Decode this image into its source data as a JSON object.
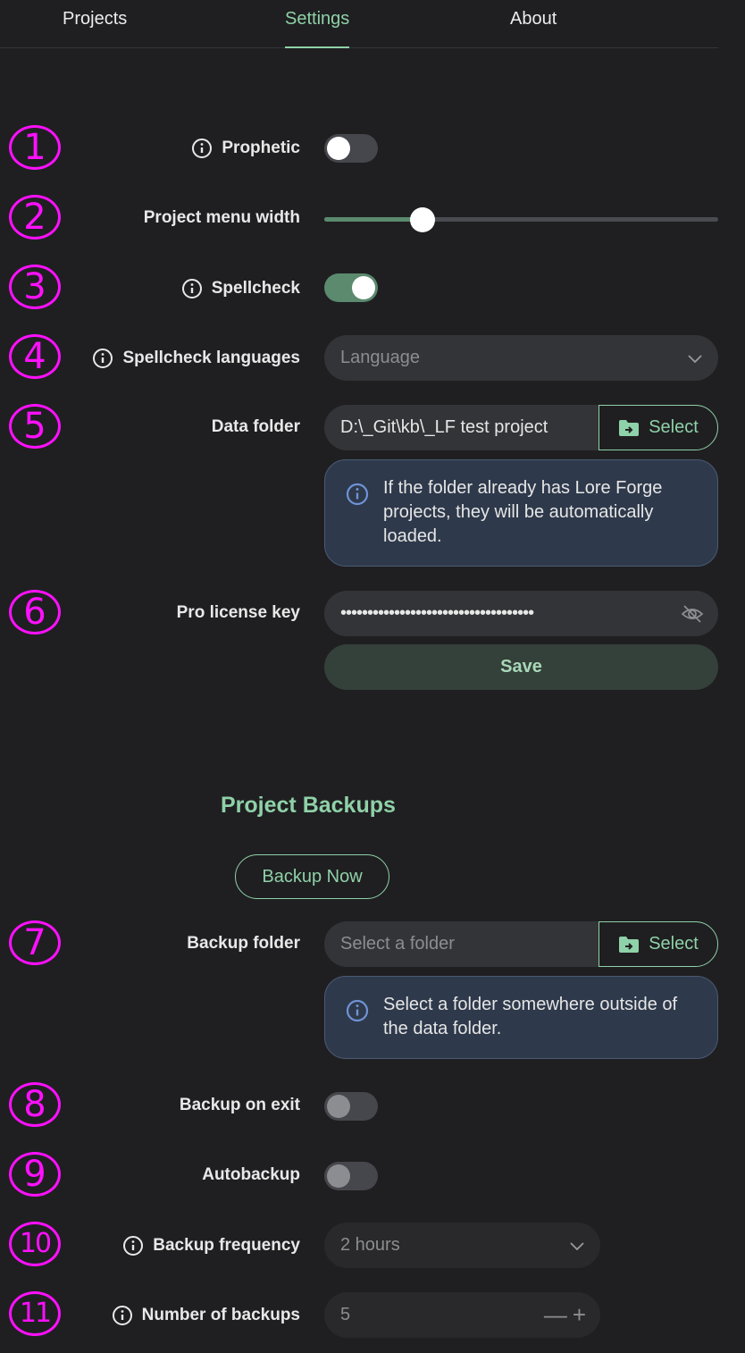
{
  "tabs": [
    {
      "label": "Projects"
    },
    {
      "label": "Settings"
    },
    {
      "label": "About"
    }
  ],
  "badges": [
    "1",
    "2",
    "3",
    "4",
    "5",
    "6",
    "7",
    "8",
    "9",
    "10",
    "11"
  ],
  "settings": {
    "prophetic": {
      "label": "Prophetic",
      "enabled": false
    },
    "menu_width": {
      "label": "Project menu width",
      "value_percent": 25
    },
    "spellcheck": {
      "label": "Spellcheck",
      "enabled": true
    },
    "spellcheck_languages": {
      "label": "Spellcheck languages",
      "placeholder": "Language"
    },
    "data_folder": {
      "label": "Data folder",
      "value": "D:\\_Git\\kb\\_LF test project",
      "select_label": "Select",
      "info": "If the folder already has Lore Forge projects, they will be automatically loaded."
    },
    "license": {
      "label": "Pro license key",
      "value": "••••••••••••••••••••••••••••••••••••",
      "save_label": "Save"
    }
  },
  "backups": {
    "title": "Project Backups",
    "backup_now_label": "Backup Now",
    "folder": {
      "label": "Backup folder",
      "placeholder": "Select a folder",
      "select_label": "Select",
      "info": "Select a folder somewhere outside of the data folder."
    },
    "on_exit": {
      "label": "Backup on exit",
      "enabled": false
    },
    "autobackup": {
      "label": "Autobackup",
      "enabled": false
    },
    "frequency": {
      "label": "Backup frequency",
      "value": "2 hours"
    },
    "count": {
      "label": "Number of backups",
      "value": "5",
      "minus": "—",
      "plus": "+"
    }
  },
  "colors": {
    "accent": "#8fd1a8",
    "badge": "#ff10ff",
    "background": "#1f1f21"
  }
}
